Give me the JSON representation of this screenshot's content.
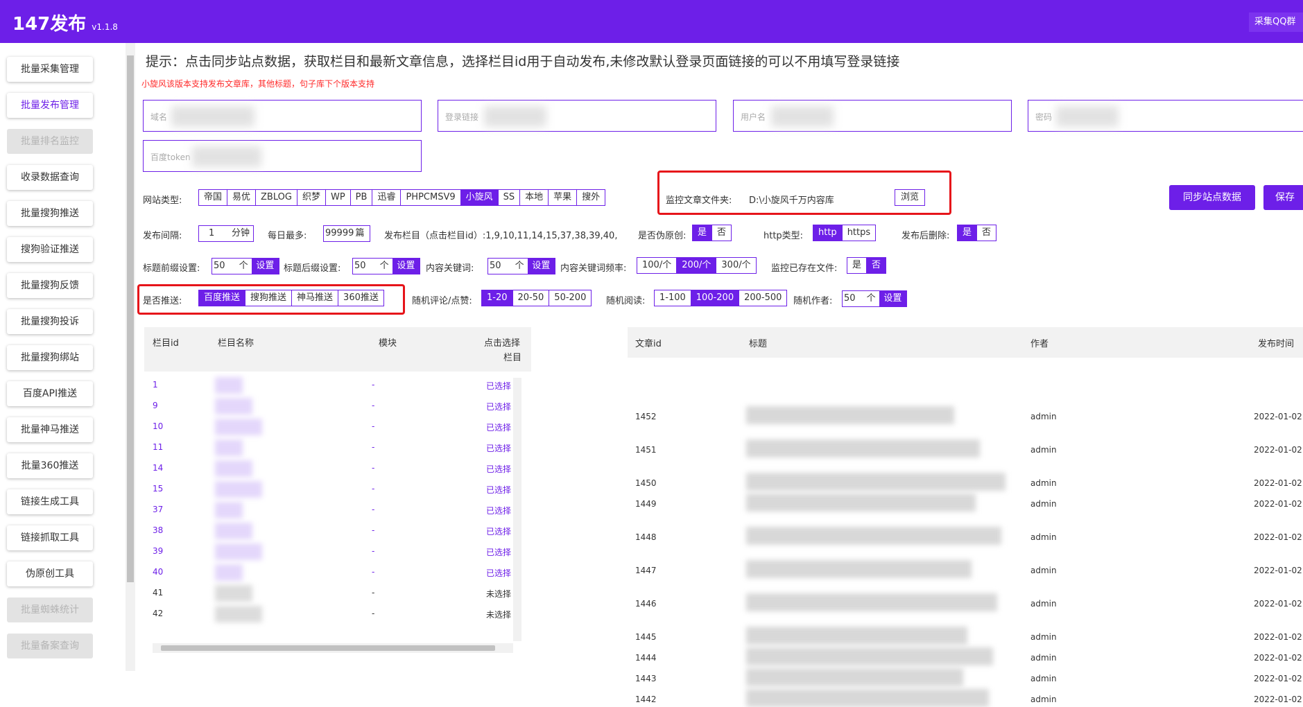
{
  "header": {
    "title": "147发布",
    "version": "v1.1.8",
    "qq": "采集QQ群"
  },
  "sidebar": {
    "items": [
      {
        "label": "批量采集管理",
        "state": "normal"
      },
      {
        "label": "批量发布管理",
        "state": "active"
      },
      {
        "label": "批量排名监控",
        "state": "disabled"
      },
      {
        "label": "收录数据查询",
        "state": "normal"
      },
      {
        "label": "批量搜狗推送",
        "state": "normal"
      },
      {
        "label": "搜狗验证推送",
        "state": "normal"
      },
      {
        "label": "批量搜狗反馈",
        "state": "normal"
      },
      {
        "label": "批量搜狗投诉",
        "state": "normal"
      },
      {
        "label": "批量搜狗绑站",
        "state": "normal"
      },
      {
        "label": "百度API推送",
        "state": "normal"
      },
      {
        "label": "批量神马推送",
        "state": "normal"
      },
      {
        "label": "批量360推送",
        "state": "normal"
      },
      {
        "label": "链接生成工具",
        "state": "normal"
      },
      {
        "label": "链接抓取工具",
        "state": "normal"
      },
      {
        "label": "伪原创工具",
        "state": "normal"
      },
      {
        "label": "批量蜘蛛统计",
        "state": "disabled"
      },
      {
        "label": "批量备案查询",
        "state": "disabled"
      }
    ]
  },
  "tips": {
    "main": "提示：点击同步站点数据，获取栏目和最新文章信息，选择栏目id用于自动发布,未修改默认登录页面链接的可以不用填写登录链接",
    "red": "小旋风该版本支持发布文章库，其他标题，句子库下个版本支持"
  },
  "fields": {
    "domain": "域名",
    "login_url": "登录链接",
    "username": "用户名",
    "password": "密码",
    "baidu_token": "百度token"
  },
  "site_type": {
    "label": "网站类型:",
    "options": [
      "帝国",
      "易优",
      "ZBLOG",
      "织梦",
      "WP",
      "PB",
      "迅睿",
      "PHPCMSV9",
      "小旋风",
      "SS",
      "本地",
      "苹果",
      "搜外"
    ],
    "selected": "小旋风"
  },
  "monitor": {
    "label": "监控文章文件夹:",
    "path": "D:\\小旋风千万内容库",
    "browse": "浏览"
  },
  "actions": {
    "sync": "同步站点数据",
    "save": "保存"
  },
  "row2": {
    "interval_label": "发布间隔:",
    "interval_value": "1",
    "interval_unit": "分钟",
    "daily_label": "每日最多:",
    "daily_value": "99999",
    "daily_unit": "篇",
    "columns_text": "发布栏目（点击栏目id）:1,9,10,11,14,15,37,38,39,40,",
    "pseudo_label": "是否伪原创:",
    "pseudo_options": [
      "是",
      "否"
    ],
    "pseudo_selected": "是",
    "http_label": "http类型:",
    "http_options": [
      "http",
      "https"
    ],
    "http_selected": "http",
    "delete_label": "发布后删除:",
    "delete_options": [
      "是",
      "否"
    ],
    "delete_selected": "是"
  },
  "row3": {
    "prefix_label": "标题前缀设置:",
    "prefix_value": "50",
    "suffix_label": "标题后缀设置:",
    "suffix_value": "50",
    "kw_label": "内容关键词:",
    "kw_value": "50",
    "unit": "个",
    "set": "设置",
    "freq_label": "内容关键词频率:",
    "freq_options": [
      "100/个",
      "200/个",
      "300/个"
    ],
    "freq_selected": "200/个",
    "exist_label": "监控已存在文件:",
    "exist_options": [
      "是",
      "否"
    ],
    "exist_selected": "否"
  },
  "row4": {
    "push_label": "是否推送:",
    "push_options": [
      "百度推送",
      "搜狗推送",
      "神马推送",
      "360推送"
    ],
    "push_selected": "百度推送",
    "comment_label": "随机评论/点赞:",
    "comment_options": [
      "1-20",
      "20-50",
      "50-200"
    ],
    "comment_selected": "1-20",
    "read_label": "随机阅读:",
    "read_options": [
      "1-100",
      "100-200",
      "200-500"
    ],
    "read_selected": "100-200",
    "author_label": "随机作者:",
    "author_value": "50",
    "unit": "个",
    "set": "设置"
  },
  "columns_table": {
    "headers": {
      "id": "栏目id",
      "name": "栏目名称",
      "module": "模块",
      "select1": "点击选择",
      "select2": "栏目"
    },
    "rows": [
      {
        "id": "1",
        "module": "-",
        "status": "已选择",
        "selected": true
      },
      {
        "id": "9",
        "module": "-",
        "status": "已选择",
        "selected": true
      },
      {
        "id": "10",
        "module": "-",
        "status": "已选择",
        "selected": true
      },
      {
        "id": "11",
        "module": "-",
        "status": "已选择",
        "selected": true
      },
      {
        "id": "14",
        "module": "-",
        "status": "已选择",
        "selected": true
      },
      {
        "id": "15",
        "module": "-",
        "status": "已选择",
        "selected": true
      },
      {
        "id": "37",
        "module": "-",
        "status": "已选择",
        "selected": true
      },
      {
        "id": "38",
        "module": "-",
        "status": "已选择",
        "selected": true
      },
      {
        "id": "39",
        "module": "-",
        "status": "已选择",
        "selected": true
      },
      {
        "id": "40",
        "module": "-",
        "status": "已选择",
        "selected": true
      },
      {
        "id": "41",
        "module": "-",
        "status": "未选择",
        "selected": false
      },
      {
        "id": "42",
        "module": "-",
        "status": "未选择",
        "selected": false
      }
    ]
  },
  "articles_table": {
    "headers": {
      "id": "文章id",
      "title": "标题",
      "author": "作者",
      "time": "发布时间"
    },
    "rows": [
      {
        "id": "1452",
        "author": "admin",
        "time": "2022-01-02"
      },
      {
        "id": "1451",
        "author": "admin",
        "time": "2022-01-02"
      },
      {
        "id": "1450",
        "author": "admin",
        "time": "2022-01-02"
      },
      {
        "id": "1449",
        "author": "admin",
        "time": "2022-01-02"
      },
      {
        "id": "1448",
        "author": "admin",
        "time": "2022-01-02"
      },
      {
        "id": "1447",
        "author": "admin",
        "time": "2022-01-02"
      },
      {
        "id": "1446",
        "author": "admin",
        "time": "2022-01-02"
      },
      {
        "id": "1445",
        "author": "admin",
        "time": "2022-01-02"
      },
      {
        "id": "1444",
        "author": "admin",
        "time": "2022-01-02"
      },
      {
        "id": "1443",
        "author": "admin",
        "time": "2022-01-02"
      },
      {
        "id": "1442",
        "author": "admin",
        "time": "2022-01-02"
      }
    ]
  },
  "colors": {
    "accent": "#6d1fe8",
    "highlight": "#e6141a"
  }
}
